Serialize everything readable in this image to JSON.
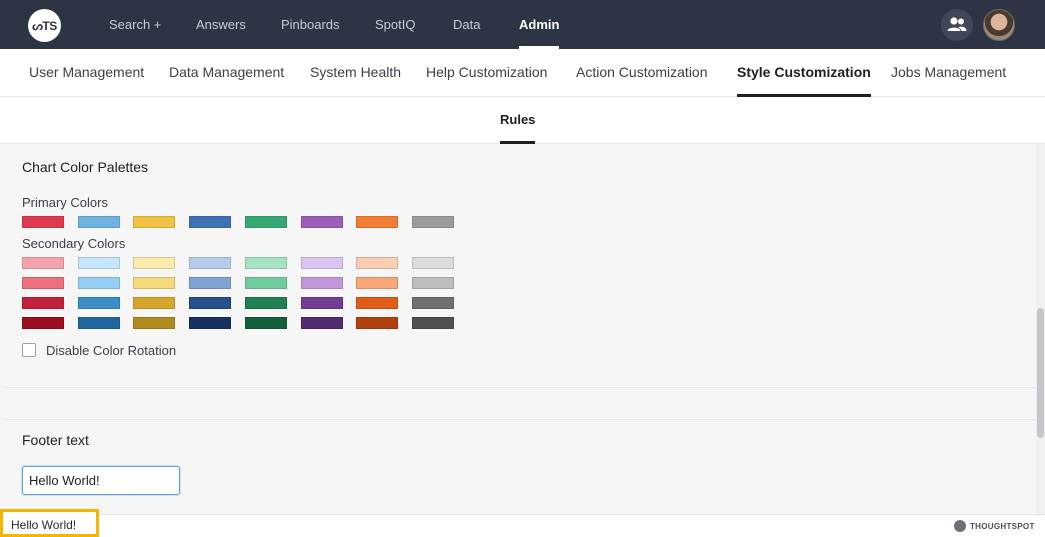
{
  "topnav": {
    "logo_text": "ᔕTS",
    "items": [
      {
        "label": "Search +"
      },
      {
        "label": "Answers"
      },
      {
        "label": "Pinboards"
      },
      {
        "label": "SpotIQ"
      },
      {
        "label": "Data"
      },
      {
        "label": "Admin",
        "active": true
      }
    ],
    "users_icon": "users-icon",
    "avatar_icon": "avatar"
  },
  "admin_tabs": [
    {
      "label": "User Management"
    },
    {
      "label": "Data Management"
    },
    {
      "label": "System Health"
    },
    {
      "label": "Help Customization"
    },
    {
      "label": "Action Customization"
    },
    {
      "label": "Style Customization",
      "active": true
    },
    {
      "label": "Jobs Management"
    }
  ],
  "sub_tab": {
    "label": "Rules"
  },
  "palettes": {
    "title": "Chart Color Palettes",
    "primary_label": "Primary Colors",
    "primary": [
      "#e03a52",
      "#6fb2e0",
      "#f0c143",
      "#3f72b5",
      "#35a873",
      "#9b5fba",
      "#f47d36",
      "#9c9c9c"
    ],
    "secondary_label": "Secondary Colors",
    "secondary": [
      [
        "#f4a3ad",
        "#c6e6fb",
        "#fbeaab",
        "#b6ccea",
        "#a6e2c4",
        "#dcc4f0",
        "#fbcdb2",
        "#dcdcdc"
      ],
      [
        "#ee6f7d",
        "#94cff3",
        "#f6d97a",
        "#7ea4d4",
        "#6fcc9e",
        "#c297da",
        "#f8a878",
        "#bdbdbd"
      ],
      [
        "#c3213a",
        "#3b8ec7",
        "#d6a62c",
        "#274f8c",
        "#218051",
        "#743d94",
        "#e05c18",
        "#707070"
      ],
      [
        "#9c0f20",
        "#1f689f",
        "#b08a1c",
        "#16305f",
        "#13603b",
        "#532b70",
        "#b0400c",
        "#505050"
      ]
    ],
    "disable_rotation_label": "Disable Color Rotation",
    "disable_rotation_checked": false
  },
  "footer_section": {
    "title": "Footer text",
    "input_value": "Hello World!"
  },
  "app_footer": {
    "text": "Hello World!",
    "brand": "THOUGHTSPOT"
  }
}
